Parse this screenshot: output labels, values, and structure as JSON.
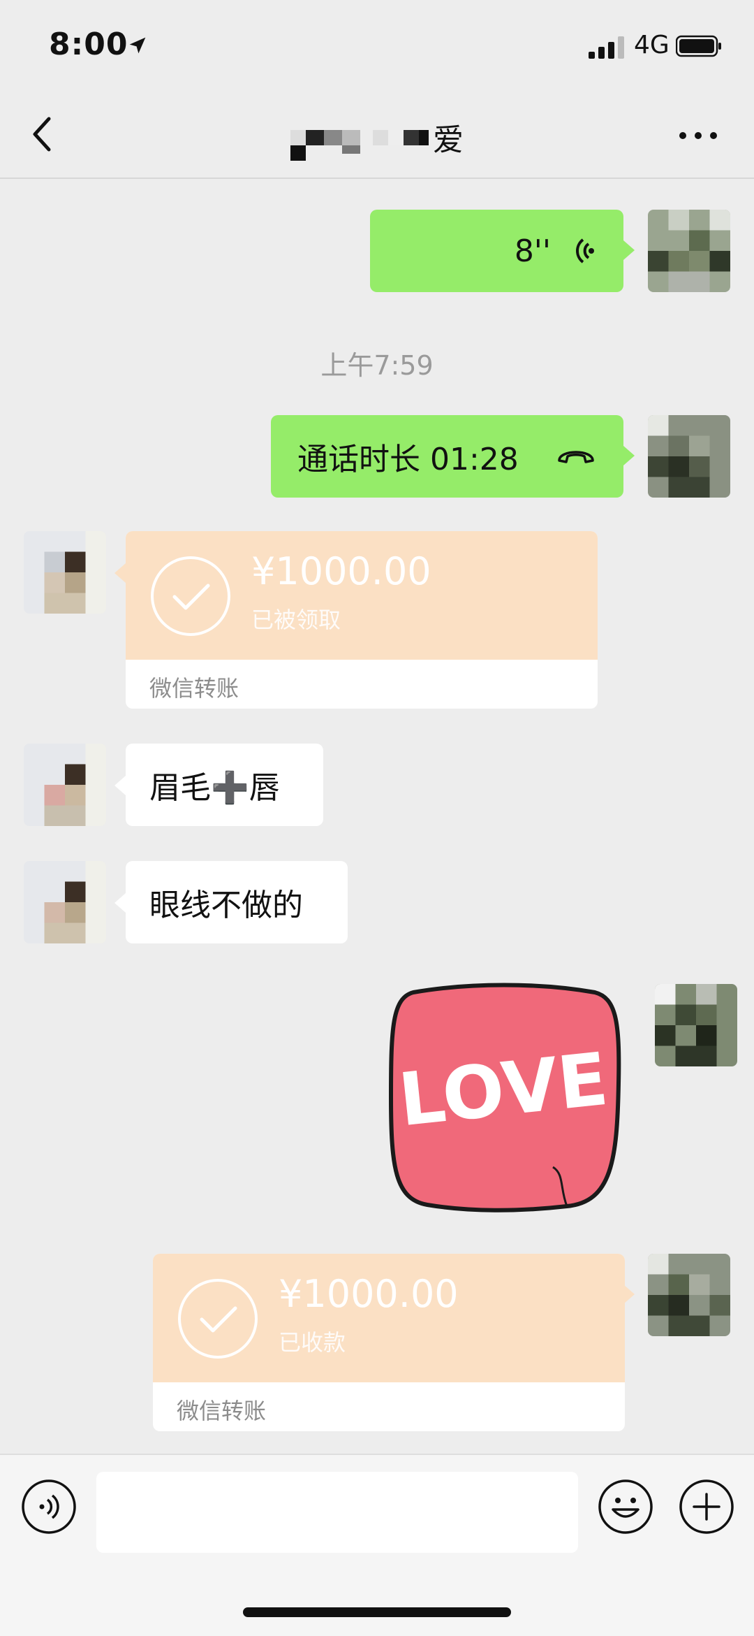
{
  "status_bar": {
    "time": "8:00",
    "network": "4G"
  },
  "header": {
    "title_visible_char": "爱"
  },
  "messages": {
    "voice": {
      "duration": "8''"
    },
    "timestamp": "上午7:59",
    "call": {
      "text": "通话时长 01:28"
    },
    "transfer_received": {
      "amount": "¥1000.00",
      "status": "已被领取",
      "label": "微信转账"
    },
    "text1": "眉毛➕唇",
    "text2": "眼线不做的",
    "sticker": {
      "text": "LOVE"
    },
    "transfer_sent": {
      "amount": "¥1000.00",
      "status": "已收款",
      "label": "微信转账"
    }
  },
  "input": {
    "value": ""
  },
  "colors": {
    "green_bubble": "#95ec69",
    "transfer_bg": "#fbe0c4",
    "sticker_red": "#f0697a"
  }
}
